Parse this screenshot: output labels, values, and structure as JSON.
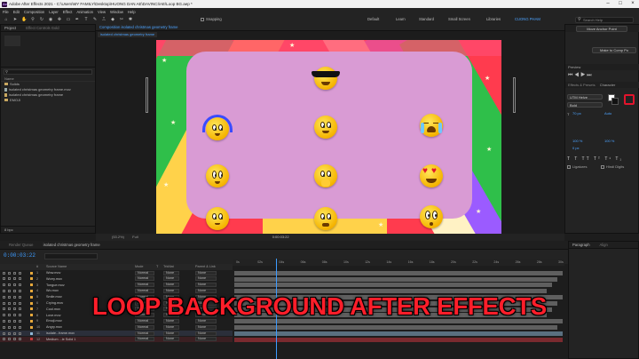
{
  "window": {
    "title": "Adobe After Effects 2021 - C:\\Users\\MY FAMILY\\Desktop\\HUONG DAN AE\\DAVINCI\\AE\\Loop BG.aep *"
  },
  "menu": [
    "File",
    "Edit",
    "Composition",
    "Layer",
    "Effect",
    "Animation",
    "View",
    "Window",
    "Help"
  ],
  "toolbar": {
    "snapping": "Snapping",
    "workspaces": [
      "Default",
      "Learn",
      "Standard",
      "Small Screen",
      "Libraries",
      "CUONG PHAM"
    ],
    "active_workspace": "CUONG PHAM",
    "search_placeholder": "Search Help"
  },
  "project": {
    "tabs": [
      "Project",
      "Effect Controls Gold"
    ],
    "items": [
      {
        "type": "folder",
        "name": "Solids"
      },
      {
        "type": "file",
        "name": "isolated christmas geometry frame.mov"
      },
      {
        "type": "file",
        "name": "isolated christmas geometry frame"
      },
      {
        "type": "file",
        "name": "EMOJI"
      }
    ],
    "footer": "8 bpc"
  },
  "composition": {
    "tab_label": "Composition isolated christmas geometry frame",
    "breadcrumb": "isolated christmas geometry frame",
    "zoom": "(53.2%)",
    "resolution": "Full",
    "timecode": "0:00:03:22"
  },
  "right_panel": {
    "move_anchor": "Move Anchor Point",
    "make_composition": "Make to Comp Po",
    "preview_label": "Preview",
    "tabs": [
      "Effects & Presets",
      "Character"
    ],
    "font": "UTM Helve",
    "style": "Bold",
    "size": "70 px",
    "leading": "Auto",
    "tracking": "100 %",
    "scale": "100 %",
    "baseline": "0 px",
    "ligatures": "Ligatures",
    "hindi_digits": "Hindi Digits"
  },
  "timeline": {
    "tabs": [
      "Render Queue",
      "isolated christmas geometry frame"
    ],
    "timecode": "0:00:03:22",
    "columns": [
      "#",
      "Source Name",
      "Mode",
      "T",
      "TrkMat",
      "Parent & Link"
    ],
    "ruler_ticks": [
      "0s",
      "02s",
      "04s",
      "06s",
      "08s",
      "10s",
      "12s",
      "14s",
      "16s",
      "18s",
      "20s",
      "22s",
      "24s",
      "26s",
      "28s",
      "30s"
    ],
    "layers": [
      {
        "num": "1",
        "name": "Wow.mov",
        "color": "#e7a93b",
        "mode": "Normal",
        "trk": "None",
        "parent": "None"
      },
      {
        "num": "2",
        "name": "Worry.mov",
        "color": "#e7a93b",
        "mode": "Normal",
        "trk": "None",
        "parent": "None"
      },
      {
        "num": "3",
        "name": "Tongue.mov",
        "color": "#e7a93b",
        "mode": "Normal",
        "trk": "None",
        "parent": "None"
      },
      {
        "num": "4",
        "name": "Wo.mov",
        "color": "#e7a93b",
        "mode": "Normal",
        "trk": "None",
        "parent": "None"
      },
      {
        "num": "5",
        "name": "Smile.mov",
        "color": "#e7a93b",
        "mode": "Normal",
        "trk": "None",
        "parent": "None"
      },
      {
        "num": "6",
        "name": "Crying.mov",
        "color": "#e7a93b",
        "mode": "Normal",
        "trk": "None",
        "parent": "None"
      },
      {
        "num": "7",
        "name": "Cool.mov",
        "color": "#e7a93b",
        "mode": "Normal",
        "trk": "None",
        "parent": "None"
      },
      {
        "num": "8",
        "name": "Love.mov",
        "color": "#e7a93b",
        "mode": "Normal",
        "trk": "None",
        "parent": "None"
      },
      {
        "num": "9",
        "name": "Emoji.mov",
        "color": "#e7a93b",
        "mode": "Normal",
        "trk": "None",
        "parent": "None"
      },
      {
        "num": "10",
        "name": "Angry.mov",
        "color": "#e7a93b",
        "mode": "Normal",
        "trk": "None",
        "parent": "None"
      },
      {
        "num": "11",
        "name": "isolate...frame.mov",
        "color": "#8fb7d6",
        "mode": "Normal",
        "trk": "None",
        "parent": "None"
      },
      {
        "num": "12",
        "name": "Medium ...le Solid 1",
        "color": "#c23a3a",
        "mode": "Normal",
        "trk": "None",
        "parent": "None"
      }
    ]
  },
  "paragraph_panel": {
    "tabs": [
      "Paragraph",
      "Align"
    ]
  },
  "banner": {
    "text": "LOOP BACKGROUND AFTER EFFECTS",
    "color": "#ff1e2a"
  },
  "icons": [
    "ae-logo",
    "folder-icon",
    "file-icon",
    "search-icon",
    "hand-icon",
    "zoom-icon",
    "pen-icon",
    "text-icon",
    "emoji-cool",
    "emoji-headphones",
    "emoji-crying",
    "emoji-love",
    "emoji-wow"
  ]
}
